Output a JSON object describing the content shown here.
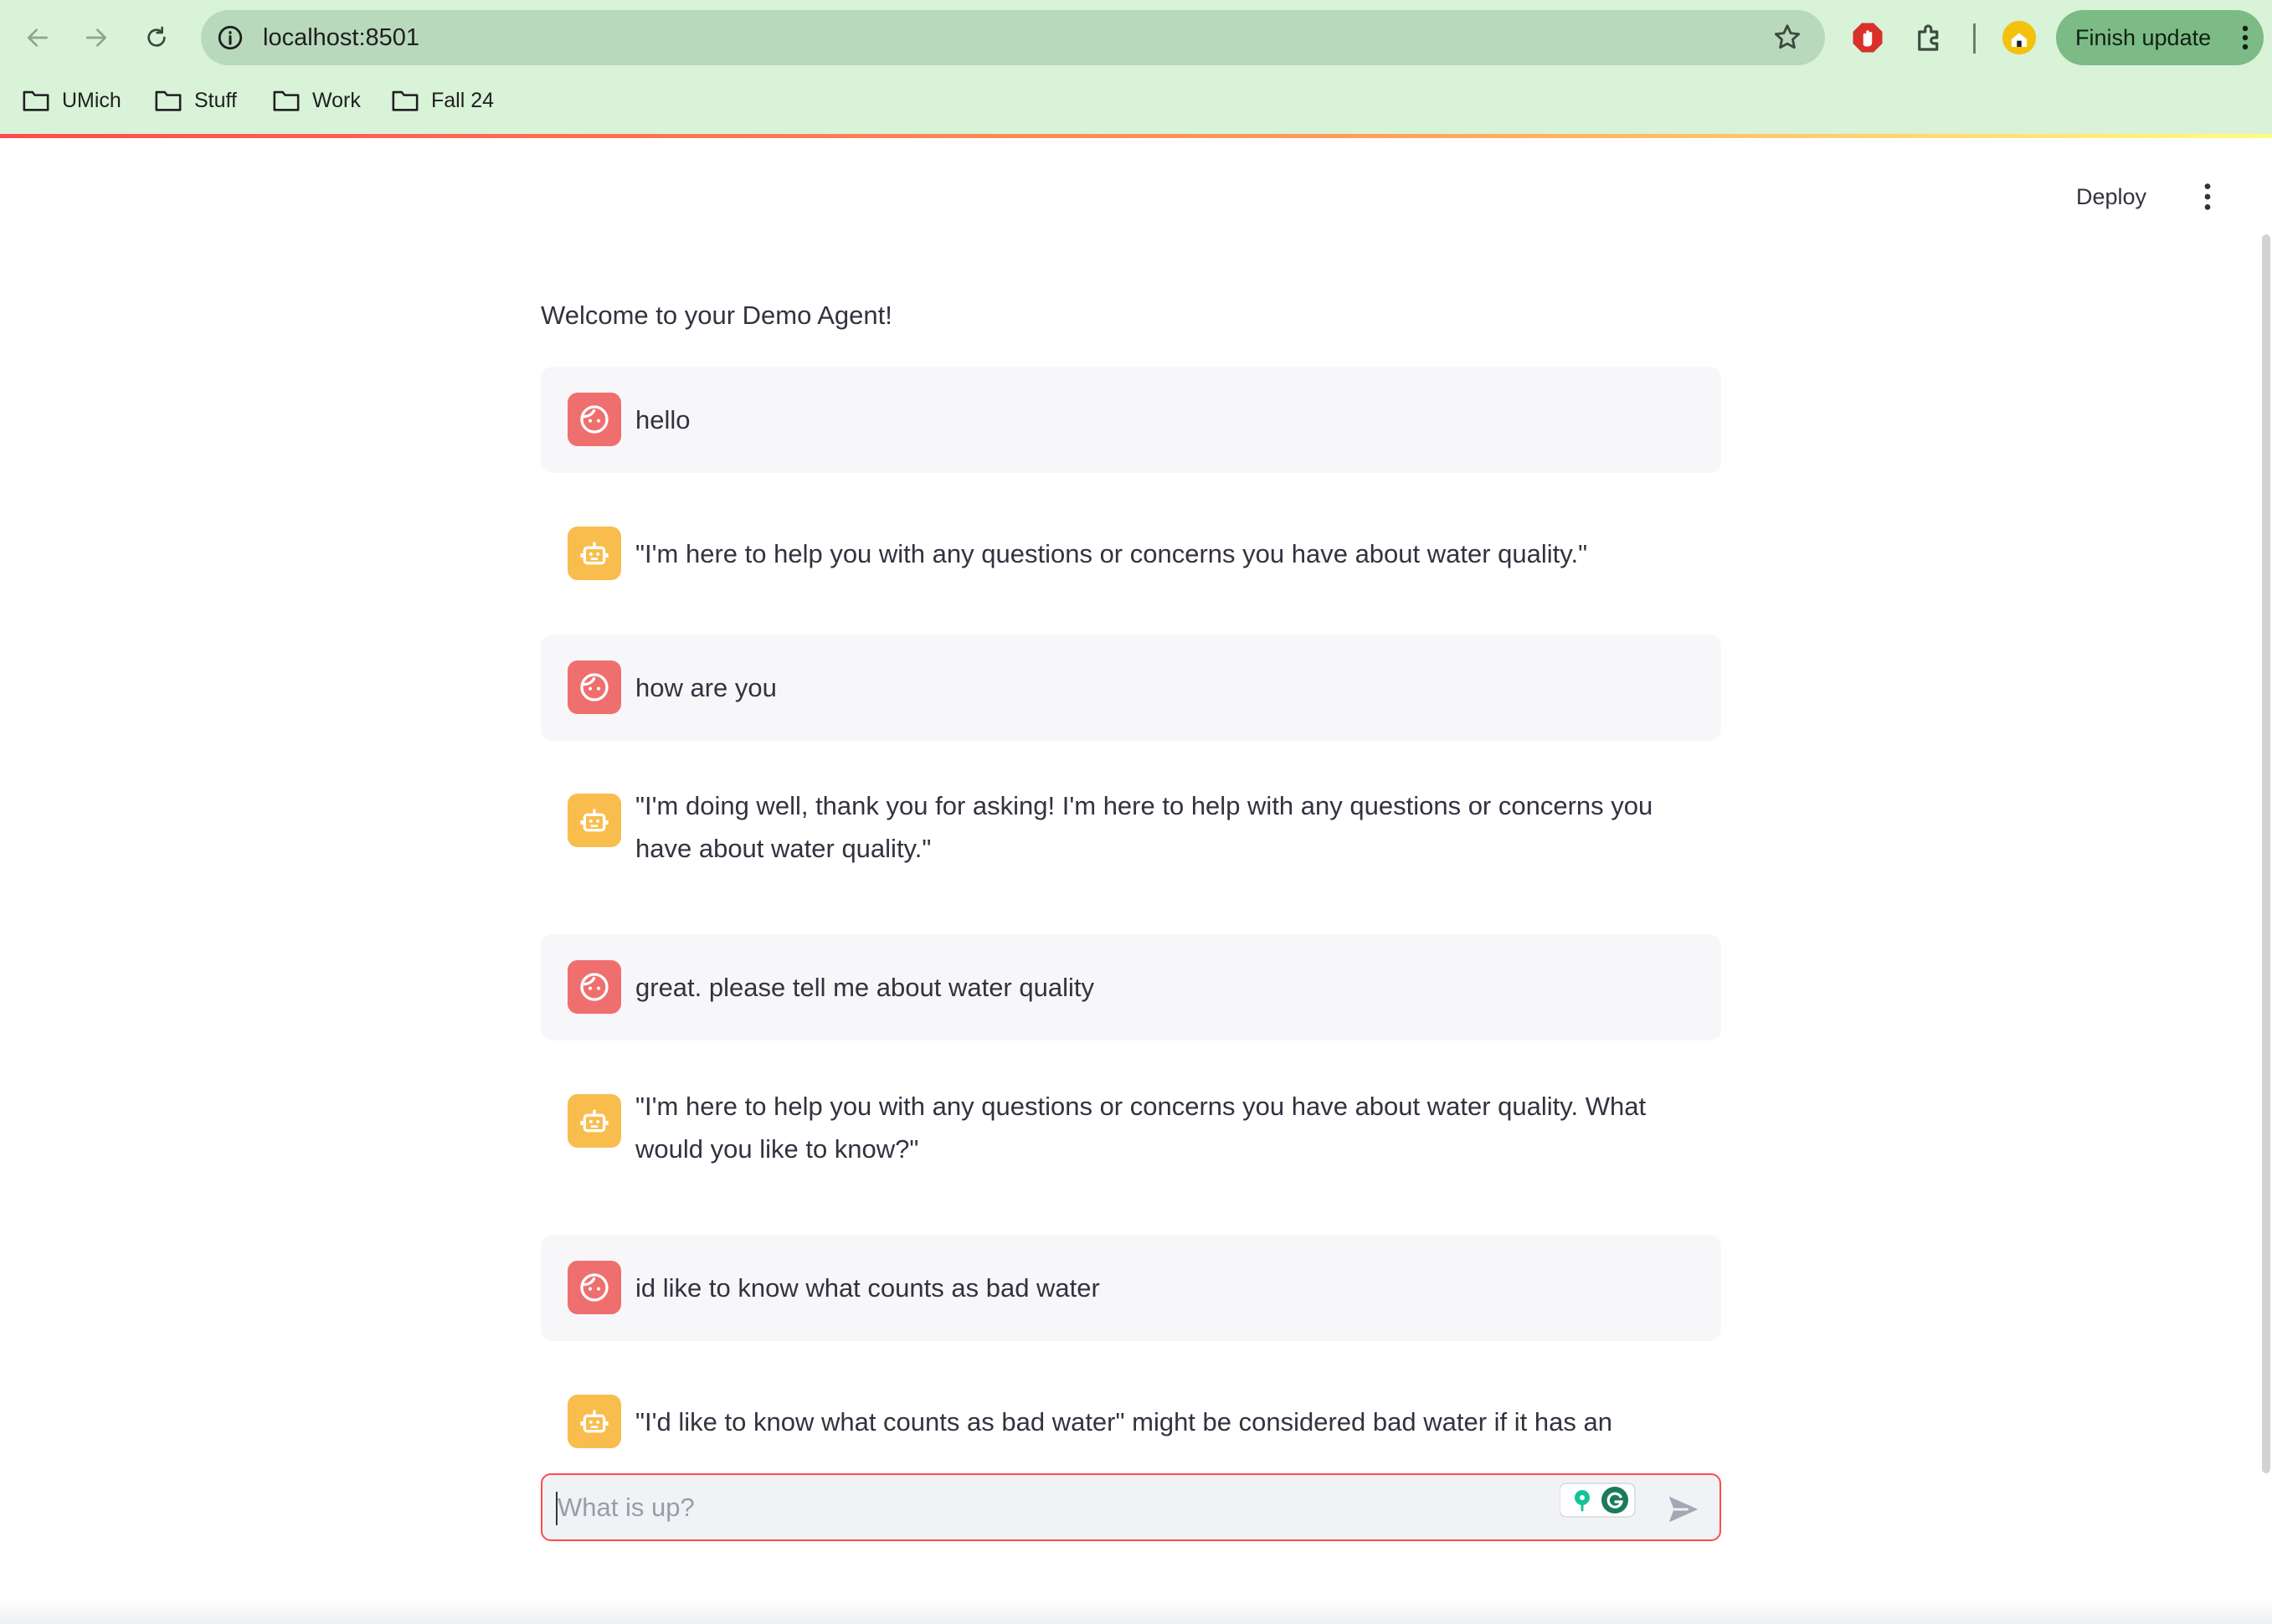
{
  "browser": {
    "url": "localhost:8501",
    "update_button": "Finish update",
    "bookmarks": [
      {
        "label": "UMich"
      },
      {
        "label": "Stuff"
      },
      {
        "label": "Work"
      },
      {
        "label": "Fall 24"
      }
    ]
  },
  "app": {
    "deploy_label": "Deploy",
    "welcome": "Welcome to your Demo Agent!",
    "messages": [
      {
        "role": "user",
        "text": "hello"
      },
      {
        "role": "assistant",
        "text": "\"I'm here to help you with any questions or concerns you have about water quality.\""
      },
      {
        "role": "user",
        "text": "how are you"
      },
      {
        "role": "assistant",
        "text": "\"I'm doing well, thank you for asking! I'm here to help with any questions or concerns you have about water quality.\""
      },
      {
        "role": "user",
        "text": "great. please tell me about water quality"
      },
      {
        "role": "assistant",
        "text": "\"I'm here to help you with any questions or concerns you have about water quality. What would you like to know?\""
      },
      {
        "role": "user",
        "text": "id like to know what counts as bad water"
      },
      {
        "role": "assistant",
        "text": "\"I'd like to know what counts as bad water\" might be considered bad water if it has an"
      }
    ],
    "chat_input": {
      "placeholder": "What is up?",
      "value": ""
    }
  },
  "colors": {
    "chrome_bg": "#d8f3d8",
    "user_avatar": "#ef6f6f",
    "assistant_avatar": "#f9bd4e",
    "accent_red": "#ff4b4b"
  },
  "icons": {
    "user_avatar": "face-icon",
    "assistant_avatar": "robot-icon",
    "send": "send-icon"
  }
}
